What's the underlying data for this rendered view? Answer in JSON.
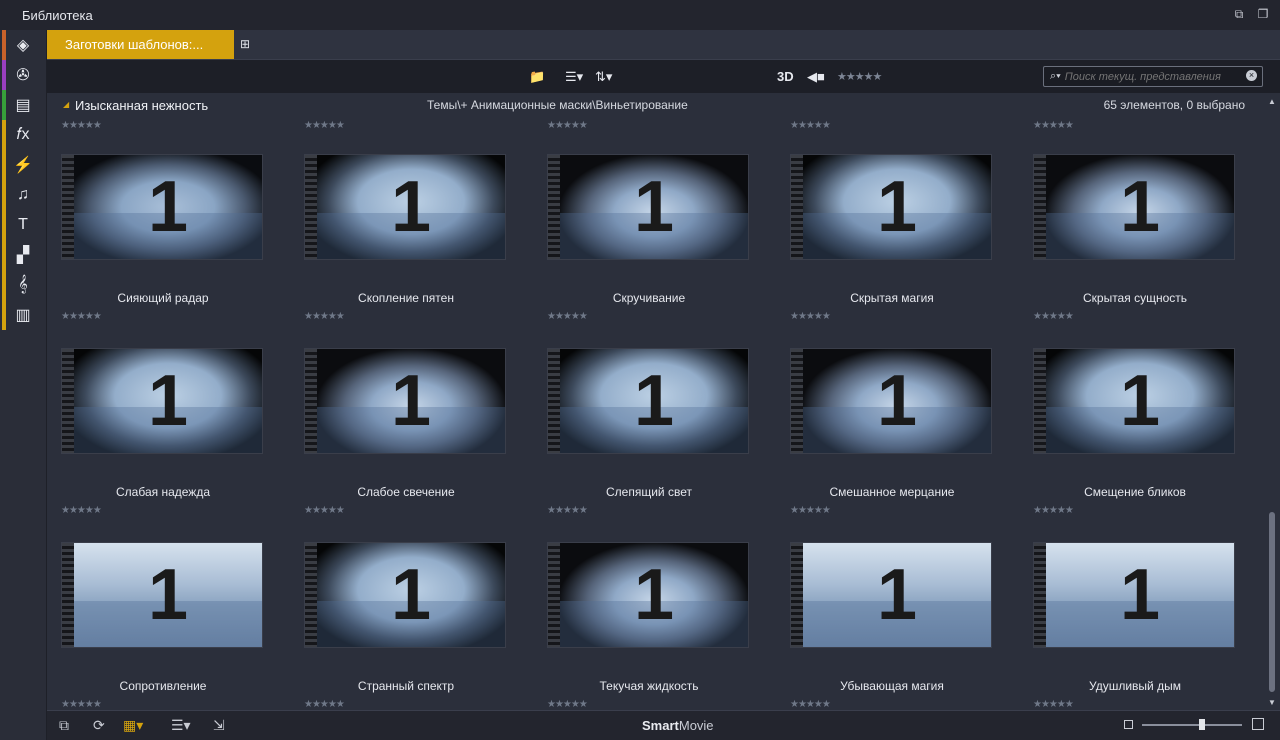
{
  "window": {
    "title": "Библиотека"
  },
  "tab": {
    "label": "Заготовки шаблонов:..."
  },
  "toolbar": {
    "mode_3d": "3D",
    "rating_filter": "★★★★★",
    "search_placeholder": "Поиск текущ. представления"
  },
  "pathbar": {
    "group": "Изысканная нежность",
    "path": "Темы\\+ Анимационные маски\\Виньетирование",
    "count": "65 элементов, 0 выбрано"
  },
  "left_nav": [
    {
      "icon": "stack-icon",
      "glyph": "◈",
      "strip": "#c9622a"
    },
    {
      "icon": "film-reel-icon",
      "glyph": "✇",
      "strip": "#9a3fc0"
    },
    {
      "icon": "photos-icon",
      "glyph": "▤",
      "strip": "#37a03a"
    },
    {
      "icon": "fx-icon",
      "glyph": "𝑓x",
      "strip": "#d4a20e"
    },
    {
      "icon": "lightning-icon",
      "glyph": "⚡",
      "strip": "#d4a20e"
    },
    {
      "icon": "music-note-icon",
      "glyph": "♫",
      "strip": "#d4a20e"
    },
    {
      "icon": "title-text-icon",
      "glyph": "T",
      "strip": "#d4a20e"
    },
    {
      "icon": "templates-icon",
      "glyph": "▞",
      "strip": "#d4a20e"
    },
    {
      "icon": "treble-clef-icon",
      "glyph": "𝄞",
      "strip": "#d4a20e"
    },
    {
      "icon": "piano-icon",
      "glyph": "▥",
      "strip": "#d4a20e"
    }
  ],
  "items": [
    {
      "name": "Сияющий радар",
      "rating": "★★★★★"
    },
    {
      "name": "Скопление пятен",
      "rating": "★★★★★"
    },
    {
      "name": "Скручивание",
      "rating": "★★★★★"
    },
    {
      "name": "Скрытая магия",
      "rating": "★★★★★"
    },
    {
      "name": "Скрытая сущность",
      "rating": "★★★★★"
    },
    {
      "name": "Слабая надежда",
      "rating": "★★★★★"
    },
    {
      "name": "Слабое свечение",
      "rating": "★★★★★"
    },
    {
      "name": "Слепящий свет",
      "rating": "★★★★★"
    },
    {
      "name": "Смешанное мерцание",
      "rating": "★★★★★"
    },
    {
      "name": "Смещение бликов",
      "rating": "★★★★★"
    },
    {
      "name": "Сопротивление",
      "rating": "★★★★★"
    },
    {
      "name": "Странный спектр",
      "rating": "★★★★★"
    },
    {
      "name": "Текучая жидкость",
      "rating": "★★★★★"
    },
    {
      "name": "Убывающая магия",
      "rating": "★★★★★"
    },
    {
      "name": "Удушливый дым",
      "rating": "★★★★★"
    }
  ],
  "thumb_number": "1",
  "bottombar": {
    "brand_bold": "Smart",
    "brand_rest": "Movie"
  }
}
